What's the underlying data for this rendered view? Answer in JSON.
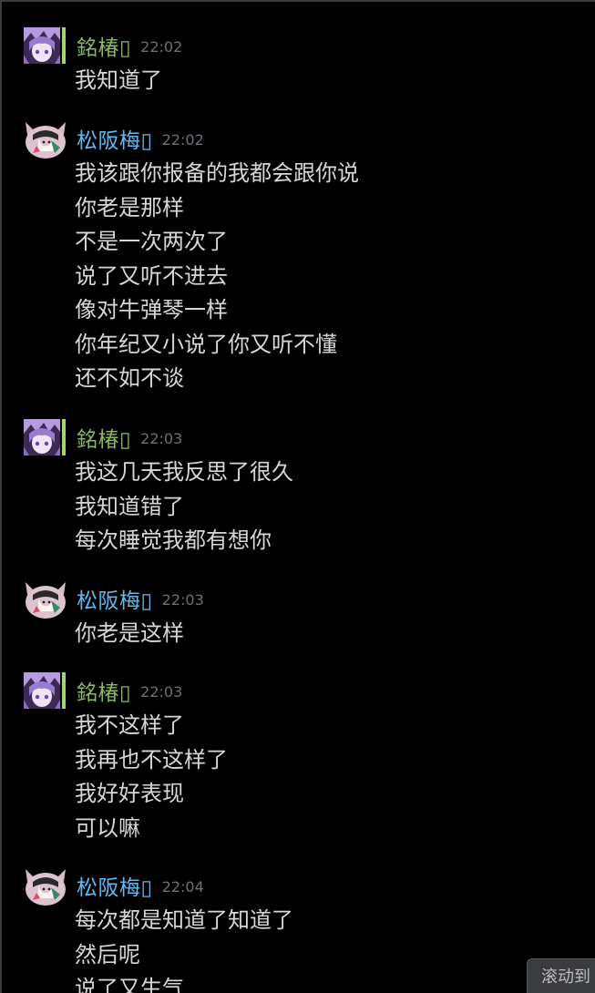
{
  "messages": [
    {
      "sender": "銘椿▯",
      "time": "22:02",
      "lines": [
        "我知道了"
      ]
    },
    {
      "sender": "松阪梅▯",
      "time": "22:02",
      "lines": [
        "我该跟你报备的我都会跟你说",
        "你老是那样",
        "不是一次两次了",
        "说了又听不进去",
        "像对牛弹琴一样",
        "你年纪又小说了你又听不懂",
        "还不如不谈"
      ]
    },
    {
      "sender": "銘椿▯",
      "time": "22:03",
      "lines": [
        "我这几天我反思了很久",
        "我知道错了",
        "每次睡觉我都有想你"
      ]
    },
    {
      "sender": "松阪梅▯",
      "time": "22:03",
      "lines": [
        "你老是这样"
      ]
    },
    {
      "sender": "銘椿▯",
      "time": "22:03",
      "lines": [
        "我不这样了",
        "我再也不这样了",
        "我好好表现",
        "可以嘛"
      ]
    },
    {
      "sender": "松阪梅▯",
      "time": "22:04",
      "lines": [
        "每次都是知道了知道了",
        "然后呢",
        "说了又生气"
      ]
    }
  ],
  "scroll_button": {
    "label": "滚动到"
  },
  "colors": {
    "background": "#000000",
    "sender_mingchun": "#8ab866",
    "sender_songbanmei": "#63b8f0",
    "timestamp": "#6d7177",
    "message_text": "#d7d7d7"
  },
  "icons": {
    "mingchun_avatar": "purple-anime-avatar",
    "songbanmei_avatar": "cat-ear-girl-avatar"
  }
}
